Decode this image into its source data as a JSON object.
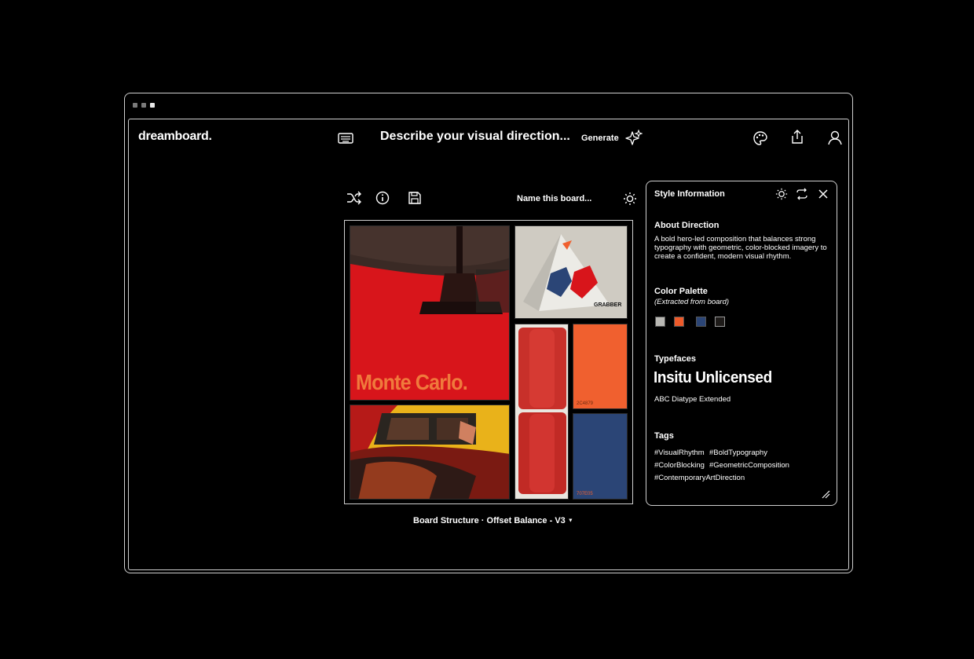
{
  "app": {
    "logo": "dreamboard."
  },
  "header": {
    "prompt_placeholder": "Describe your visual direction...",
    "generate_label": "Generate"
  },
  "toolbar": {
    "board_name_placeholder": "Name this board..."
  },
  "board": {
    "tiles": [
      {
        "name": "monte-carlo-poster",
        "text": "Monte Carlo.",
        "color": "#d8151b"
      },
      {
        "name": "grabber-package",
        "text": "GRABBER",
        "color": "#e9e6df"
      },
      {
        "name": "red-seat",
        "text": "",
        "color": "#c8302a"
      },
      {
        "name": "orange-swatch-card",
        "text": "2C4879",
        "color": "#f0602f"
      },
      {
        "name": "blue-swatch-card",
        "text": "707E05",
        "color": "#2b4576"
      },
      {
        "name": "taxi-photo",
        "text": "",
        "color": "#b61a18"
      }
    ],
    "caption": "Board Structure · Offset Balance - V3"
  },
  "style_panel": {
    "title": "Style Information",
    "about_heading": "About Direction",
    "about_text": "A bold hero-led composition that balances strong typography with geometric, color-blocked imagery to create a confident, modern visual rhythm.",
    "palette_heading": "Color Palette",
    "palette_sub": "(Extracted from board)",
    "palette": [
      "#b9b8b4",
      "#ee5a2a",
      "#2b4576",
      "#1e1b19"
    ],
    "typefaces_heading": "Typefaces",
    "typeface_primary": "Insitu Unlicensed",
    "typeface_secondary": "ABC Diatype Extended",
    "tags_heading": "Tags",
    "tags": [
      "#VisualRhythm",
      "#BoldTypography",
      "#ColorBlocking",
      "#GeometricComposition",
      "#ContemporaryArtDirection"
    ]
  }
}
